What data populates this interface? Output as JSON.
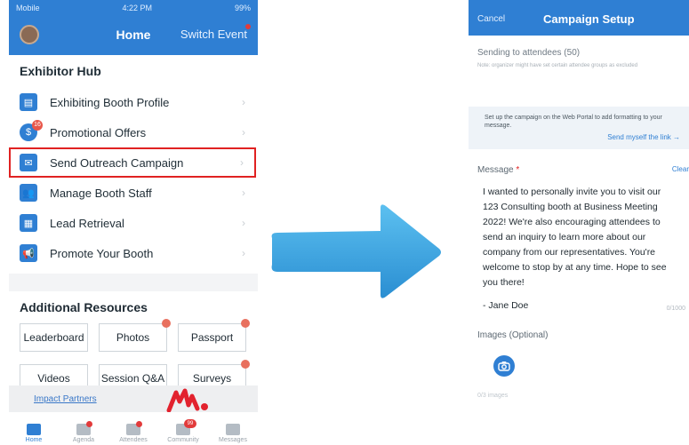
{
  "left": {
    "status": {
      "carrier": "Mobile",
      "time": "4:22 PM",
      "battery": "99%"
    },
    "nav": {
      "title": "Home",
      "switch": "Switch Event"
    },
    "hub": {
      "title": "Exhibitor Hub",
      "items": [
        {
          "label": "Exhibiting Booth Profile",
          "icon": "booth-icon",
          "glyph": "▤"
        },
        {
          "label": "Promotional Offers",
          "icon": "offers-icon",
          "glyph": "$",
          "badge": "16"
        },
        {
          "label": "Send Outreach Campaign",
          "icon": "mail-icon",
          "glyph": "✉",
          "highlighted": true
        },
        {
          "label": "Manage Booth Staff",
          "icon": "staff-icon",
          "glyph": "👥"
        },
        {
          "label": "Lead Retrieval",
          "icon": "scan-icon",
          "glyph": "▦"
        },
        {
          "label": "Promote Your Booth",
          "icon": "megaphone-icon",
          "glyph": "📢"
        }
      ],
      "chevron": "›"
    },
    "resources": {
      "title": "Additional Resources",
      "tiles": [
        {
          "label": "Leaderboard",
          "dot": false
        },
        {
          "label": "Photos",
          "dot": true
        },
        {
          "label": "Passport",
          "dot": true
        },
        {
          "label": "Videos",
          "dot": false
        },
        {
          "label": "Session Q&A",
          "dot": false
        },
        {
          "label": "Surveys",
          "dot": true
        }
      ]
    },
    "impact": {
      "link": "Impact Partners"
    },
    "tabs": [
      {
        "label": "Home",
        "active": true
      },
      {
        "label": "Agenda",
        "dot": true
      },
      {
        "label": "Attendees",
        "dot": true
      },
      {
        "label": "Community",
        "badge": "99"
      },
      {
        "label": "Messages"
      }
    ]
  },
  "right": {
    "cancel": "Cancel",
    "title": "Campaign Setup",
    "sending": "Sending to attendees (50)",
    "note": "Note: organizer might have set certain attendee groups as excluded",
    "portal": {
      "text": "Set up the campaign on the Web Portal to add formatting to your message.",
      "link": "Send myself the link →"
    },
    "message": {
      "label": "Message",
      "required": "*",
      "clear": "Clear",
      "body": "I wanted to personally invite you to visit our 123 Consulting booth at Business Meeting 2022! We're also encouraging attendees to send an inquiry to learn more about our company from our representatives. You're welcome to stop by at any time. Hope to see you there!",
      "signature": "- Jane Doe",
      "count": "0/1000"
    },
    "images": {
      "label": "Images (Optional)",
      "count": "0/3 images"
    }
  },
  "colors": {
    "brand": "#2f7fd3",
    "highlight": "#e02222",
    "arrow": "#3aa0dd"
  }
}
